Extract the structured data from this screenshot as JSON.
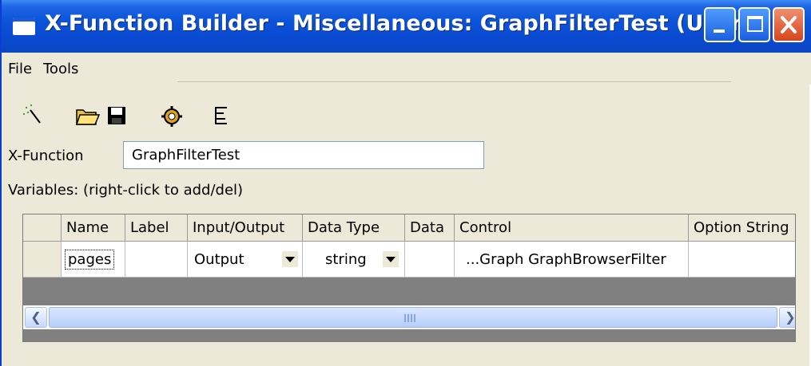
{
  "window": {
    "title": "X-Function Builder - Miscellaneous: GraphFilterTest (User)"
  },
  "titlebar_buttons": [
    "minimize-icon",
    "maximize-icon",
    "close-icon"
  ],
  "menu": [
    "File",
    "Tools"
  ],
  "toolbar": [
    "new-wand-icon",
    "open-folder-icon",
    "save-disk-icon",
    "compile-gear-icon",
    "tree-view-icon"
  ],
  "form": {
    "xfunction_label": "X-Function",
    "xfunction_value": "GraphFilterTest",
    "variables_label": "Variables: (right-click to add/del)"
  },
  "grid": {
    "columns": [
      "Name",
      "Label",
      "Input/Output",
      "Data Type",
      "Data",
      "Control",
      "Option String"
    ],
    "rows": [
      {
        "name": "pages",
        "label": "",
        "io": "Output",
        "dtype": "string",
        "data": "",
        "control": "...Graph GraphBrowserFilter",
        "option": ""
      }
    ]
  },
  "colors": {
    "titlebar": "#0b53d8",
    "window_bg": "#ece9d8",
    "close_button": "#d8431c"
  }
}
